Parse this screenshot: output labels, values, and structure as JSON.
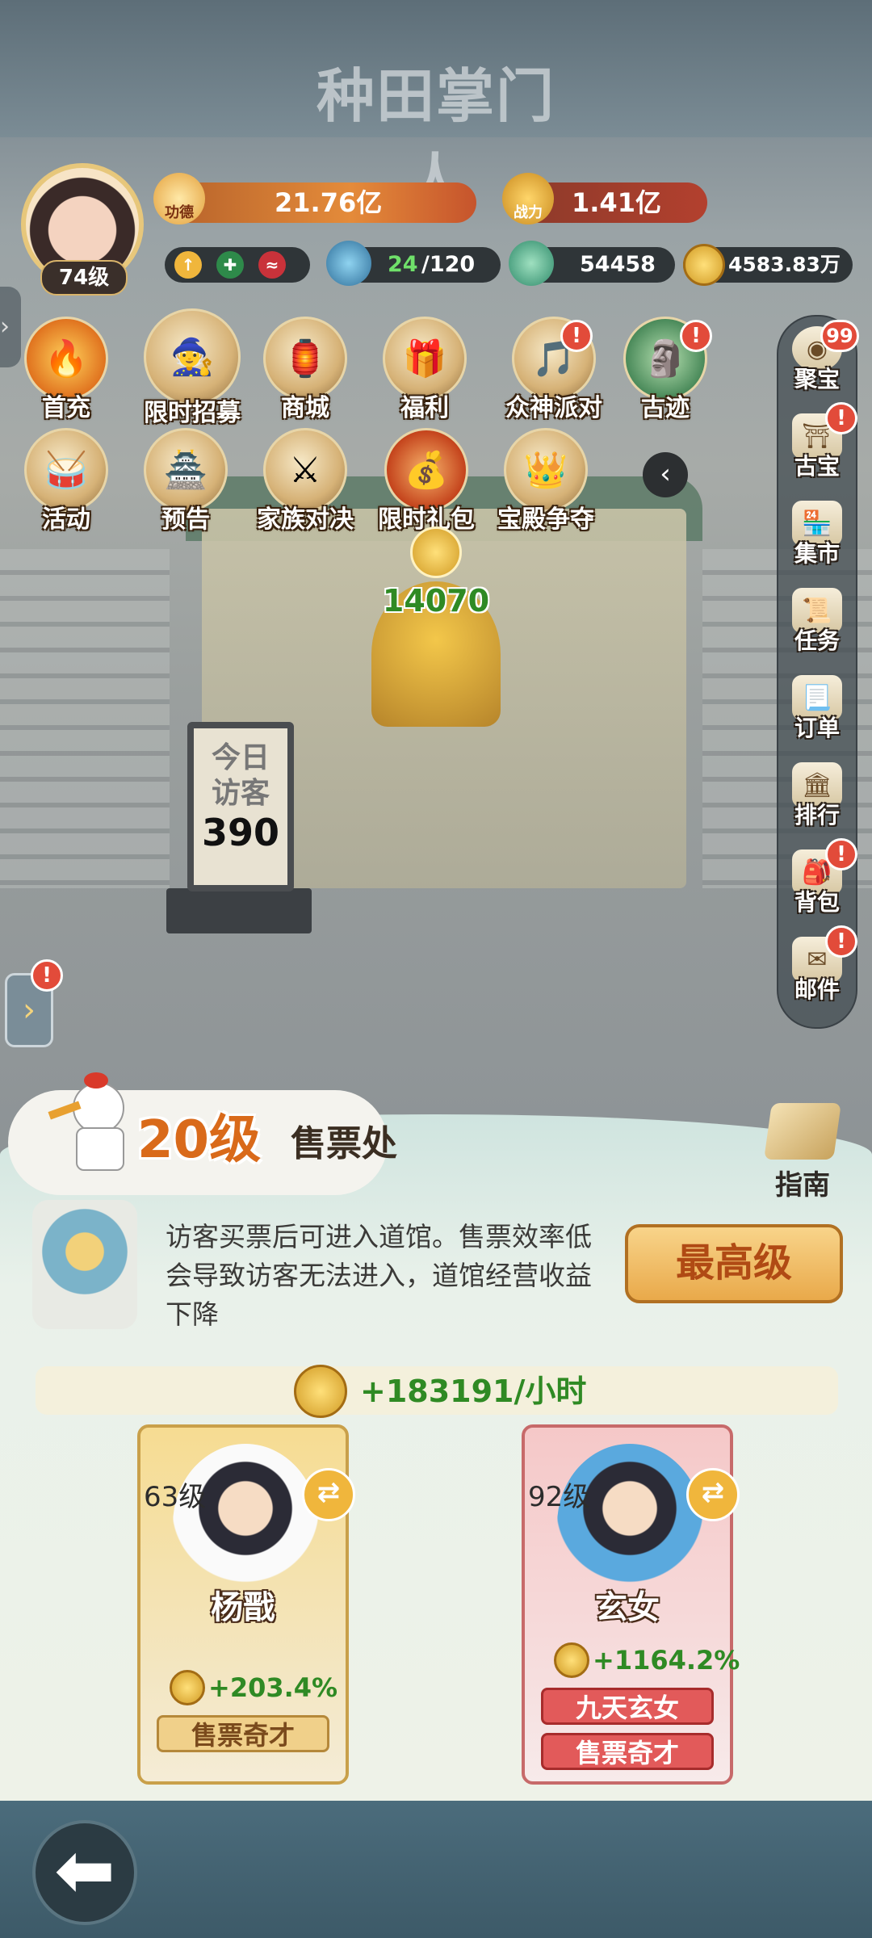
{
  "game_title": "种田掌门人",
  "player": {
    "level": "74级",
    "gongde_label": "功德",
    "gongde": "21.76亿",
    "zhanli_label": "战力",
    "zhanli": "1.41亿",
    "stamina": "24",
    "stamina_max": "/120",
    "jade": "54458",
    "coins": "4583.83万"
  },
  "top_icons": [
    {
      "label": "首充",
      "icon": "flame-icon"
    },
    {
      "label": "限时招募",
      "icon": "recruit-icon"
    },
    {
      "label": "商城",
      "icon": "shop-icon"
    },
    {
      "label": "福利",
      "icon": "gift-icon"
    },
    {
      "label": "众神派对",
      "icon": "party-icon",
      "alert": "!"
    },
    {
      "label": "古迹",
      "icon": "ruins-icon",
      "alert": "!"
    }
  ],
  "second_icons": [
    {
      "label": "活动",
      "icon": "drum-icon"
    },
    {
      "label": "预告",
      "icon": "notice-icon"
    },
    {
      "label": "家族对决",
      "icon": "family-duel-icon"
    },
    {
      "label": "限时礼包",
      "icon": "bag-icon"
    },
    {
      "label": "宝殿争夺",
      "icon": "palace-icon"
    }
  ],
  "sidebar": [
    {
      "label": "聚宝",
      "badge": "99"
    },
    {
      "label": "古宝",
      "alert": "!"
    },
    {
      "label": "集市"
    },
    {
      "label": "任务"
    },
    {
      "label": "订单"
    },
    {
      "label": "排行"
    },
    {
      "label": "背包",
      "alert": "!"
    },
    {
      "label": "邮件",
      "alert": "!"
    }
  ],
  "scene": {
    "coin_pile": "14070",
    "board_title_1": "今日",
    "board_title_2": "访客",
    "visitors": "390"
  },
  "left_alert": "!",
  "booth": {
    "level": "20级",
    "name": "售票处",
    "guide": "指南",
    "description": "访客买票后可进入道馆。售票效率低会导致访客无法进入，道馆经营收益下降",
    "max_button": "最高级",
    "income": "+183191/小时"
  },
  "characters": [
    {
      "level": "63级",
      "name": "杨戬",
      "bonus": "+203.4%",
      "tags": [
        "售票奇才"
      ]
    },
    {
      "level": "92级",
      "name": "玄女",
      "bonus": "+1164.2%",
      "tags": [
        "九天玄女",
        "售票奇才"
      ]
    }
  ],
  "colors": {
    "income_green": "#2f8a24",
    "level_orange": "#d96a1a",
    "alert_red": "#e24b3a"
  }
}
